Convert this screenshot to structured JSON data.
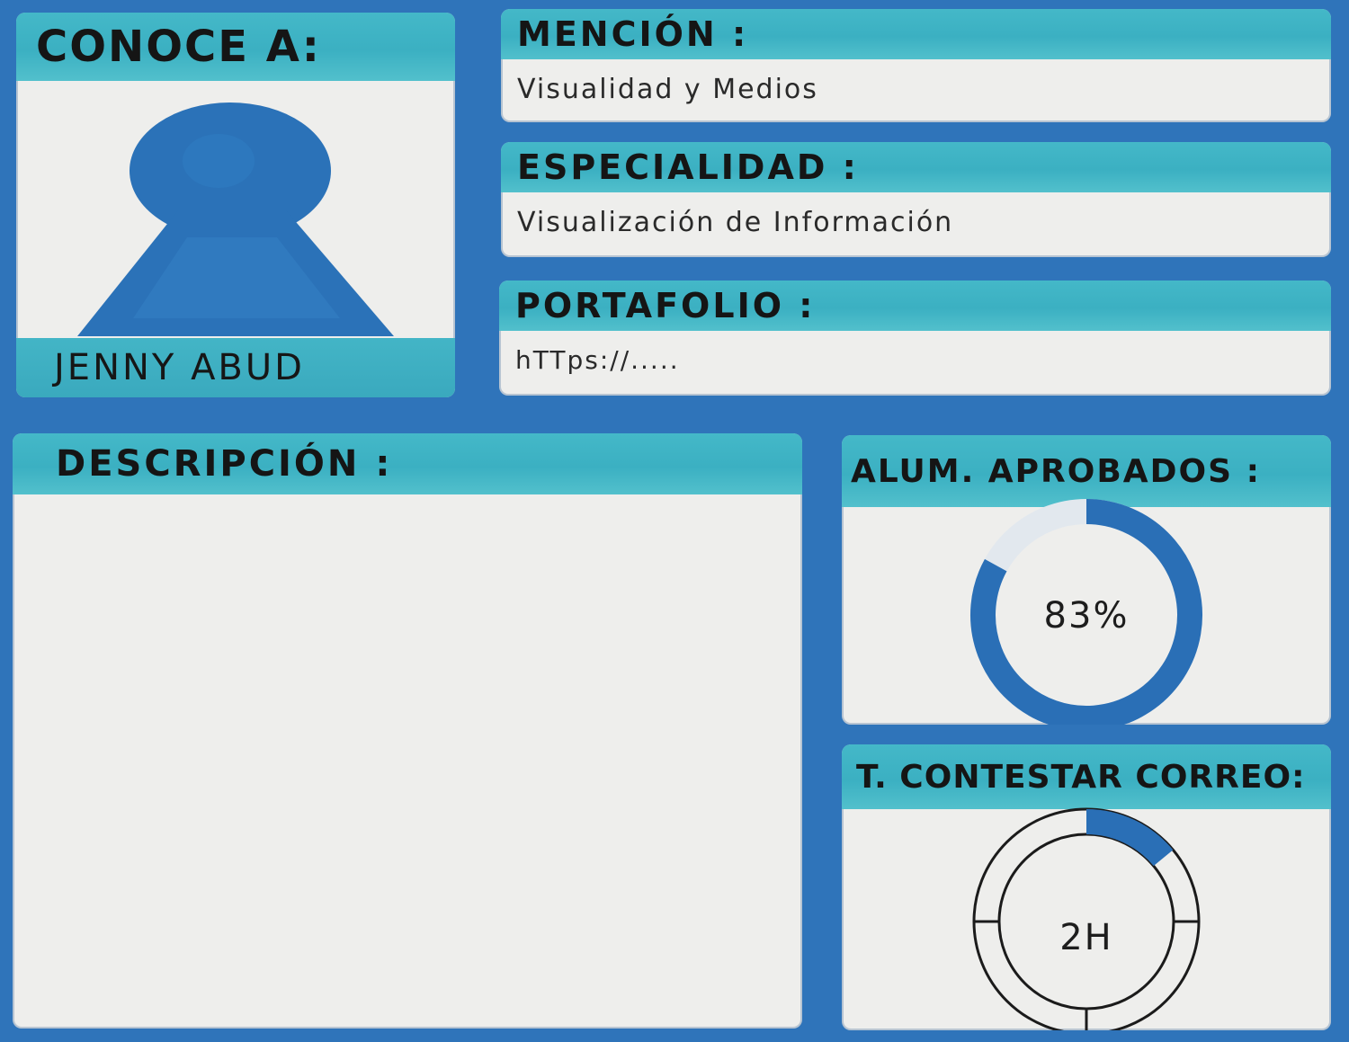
{
  "profile": {
    "heading": "CONOCE A:",
    "name": "JENNY ABUD",
    "avatar_icon": "person-icon"
  },
  "fields": {
    "mencion": {
      "label": "MENCIÓN :",
      "value": "Visualidad y Medios"
    },
    "especialidad": {
      "label": "ESPECIALIDAD :",
      "value": "Visualización de Información"
    },
    "portafolio": {
      "label": "PORTAFOLIO :",
      "value": "hTTps://....."
    }
  },
  "descripcion": {
    "label": "DESCRIPCIÓN :"
  },
  "metrics": {
    "aprobados": {
      "label": "ALUM. APROBADOS :",
      "value_text": "83%",
      "fraction": 0.83
    },
    "contestar": {
      "label": "T. CONTESTAR CORREO:",
      "value_text": "2H",
      "fraction": 0.14
    }
  },
  "colors": {
    "frame": "#2f74ba",
    "header": "#3fb3c4",
    "panel": "#eeeeec",
    "accent": "#2a6fb6"
  }
}
